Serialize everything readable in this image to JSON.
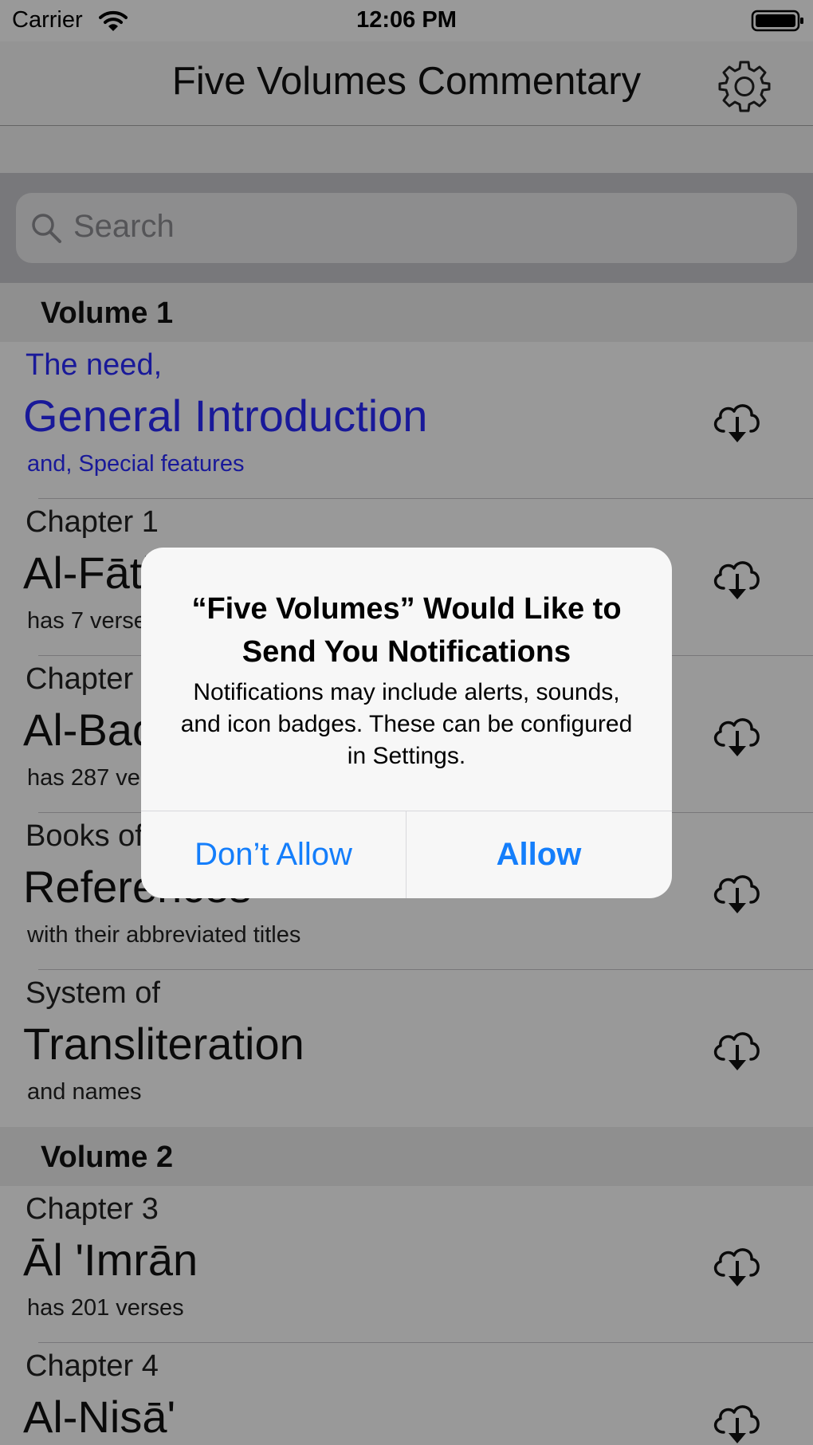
{
  "status_bar": {
    "carrier": "Carrier",
    "time": "12:06 PM",
    "wifi_icon": "wifi-icon",
    "battery_icon": "battery-icon"
  },
  "nav": {
    "title": "Five Volumes Commentary",
    "settings_icon": "gear-icon"
  },
  "search": {
    "placeholder": "Search",
    "icon": "search-icon"
  },
  "sections": [
    {
      "title": "Volume 1",
      "rows": [
        {
          "line1": "The need,",
          "line2": "General Introduction",
          "line3": "and, Special features",
          "icon": "cloud-download-icon"
        },
        {
          "line1": "Chapter 1",
          "line2": "Al-Fātiḥah",
          "line3": "has 7 verses",
          "icon": "cloud-download-icon"
        },
        {
          "line1": "Chapter 2",
          "line2": "Al-Baqarah",
          "line3": "has 287 verses",
          "icon": "cloud-download-icon"
        },
        {
          "line1": "Books of",
          "line2": "References",
          "line3": "with their abbreviated titles",
          "icon": "cloud-download-icon"
        },
        {
          "line1": "System of",
          "line2": "Transliteration",
          "line3": "and names",
          "icon": "cloud-download-icon"
        }
      ]
    },
    {
      "title": "Volume 2",
      "rows": [
        {
          "line1": "Chapter 3",
          "line2": "Āl 'Imrān",
          "line3": "has 201 verses",
          "icon": "cloud-download-icon"
        },
        {
          "line1": "Chapter 4",
          "line2": "Al-Nisā'",
          "line3": "",
          "icon": "cloud-download-icon"
        }
      ]
    }
  ],
  "colors": {
    "intro_text": "#2b2bff",
    "alert_button": "#147efb"
  },
  "alert": {
    "title": "“Five Volumes” Would Like to Send You Notifications",
    "message": "Notifications may include alerts, sounds, and icon badges. These can be configured in Settings.",
    "deny_label": "Don’t Allow",
    "allow_label": "Allow"
  }
}
